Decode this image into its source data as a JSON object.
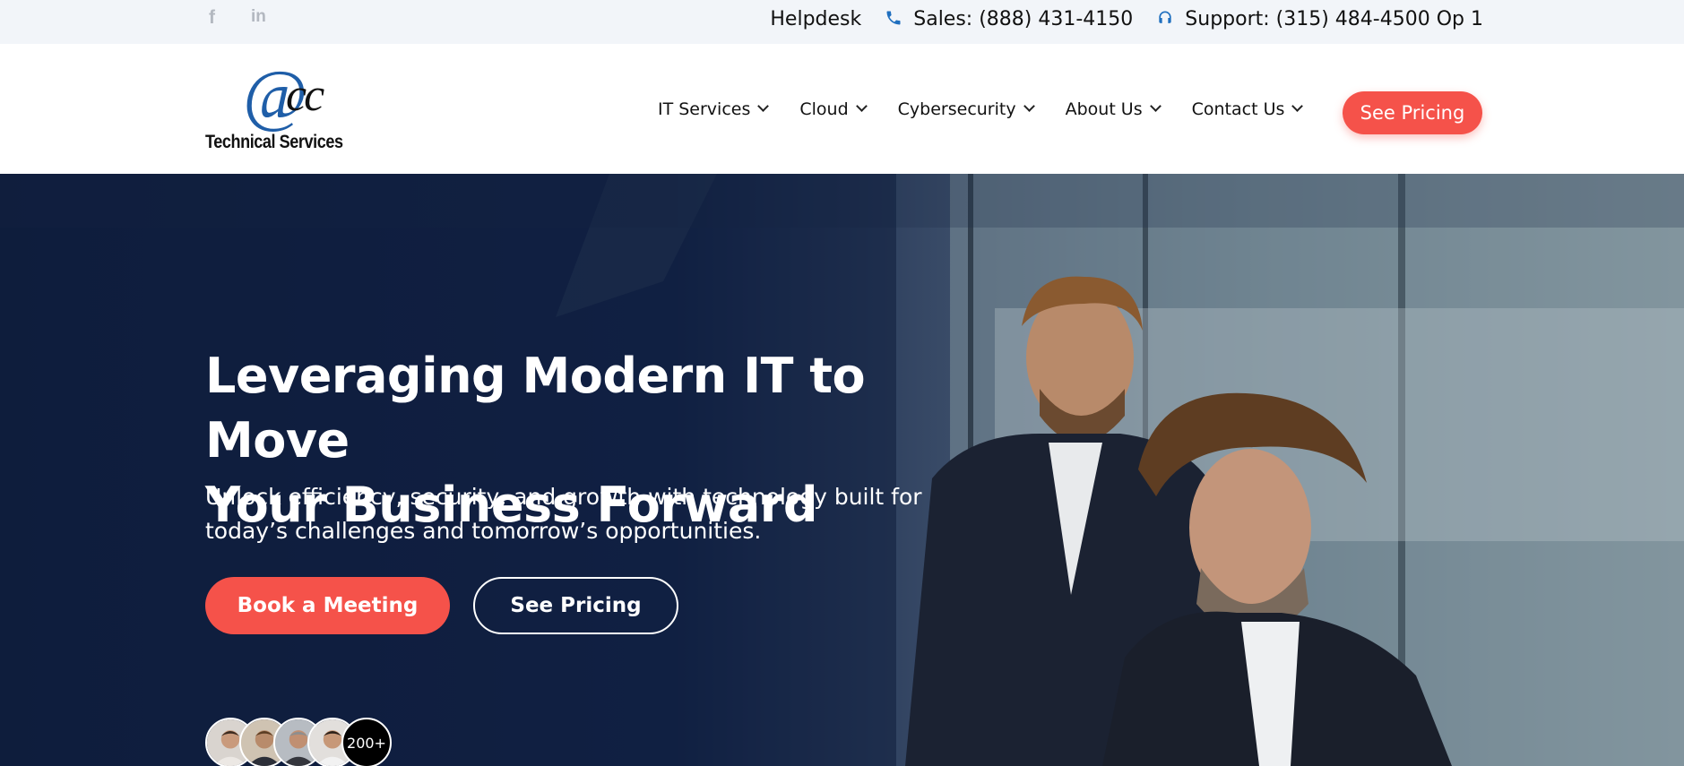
{
  "topbar": {
    "social": [
      {
        "name": "facebook",
        "glyph": "f"
      },
      {
        "name": "linkedin",
        "glyph": "in"
      }
    ],
    "helpdesk": "Helpdesk",
    "sales": "Sales: (888) 431-4150",
    "support": "Support: (315) 484-4500 Op 1",
    "icon_color": "#1f6fbf"
  },
  "header": {
    "logo": {
      "mark": "@cc",
      "mark_at": "@",
      "mark_cc": "cc",
      "subtitle": "Technical Services"
    },
    "nav": [
      {
        "label": "IT Services"
      },
      {
        "label": "Cloud"
      },
      {
        "label": "Cybersecurity"
      },
      {
        "label": "About Us"
      },
      {
        "label": "Contact Us"
      }
    ],
    "cta": "See Pricing"
  },
  "hero": {
    "title_line1": "Leveraging Modern IT to Move",
    "title_line2": "Your Business Forward",
    "subtitle_line1": "Unlock efficiency, security, and growth with technology built for",
    "subtitle_line2": "today’s challenges and tomorrow’s opportunities.",
    "primary_button": "Book a Meeting",
    "secondary_button": "See Pricing",
    "clients_count": "200+"
  },
  "colors": {
    "accent": "#f5524a",
    "hero_navy": "#13244a",
    "logo_blue": "#1f5ea8"
  }
}
